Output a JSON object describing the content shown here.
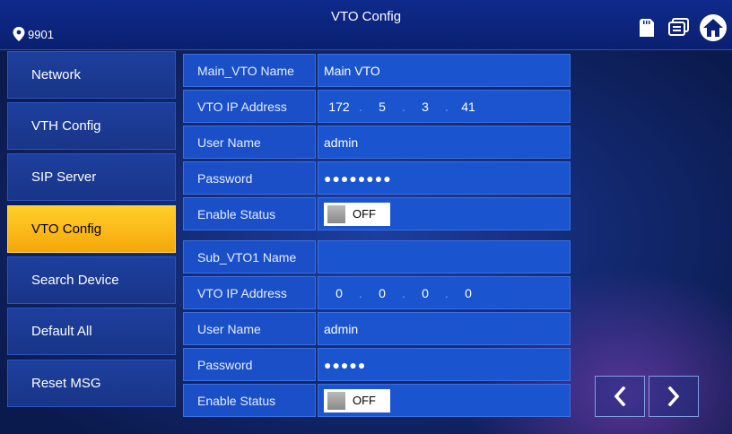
{
  "header": {
    "room_number": "9901",
    "title": "VTO Config",
    "icons": [
      "location-pin-icon",
      "sd-card-icon",
      "message-icon",
      "home-icon"
    ]
  },
  "sidebar": {
    "items": [
      {
        "label": "Network"
      },
      {
        "label": "VTH Config"
      },
      {
        "label": "SIP Server"
      },
      {
        "label": "VTO Config",
        "active": true
      },
      {
        "label": "Search Device"
      },
      {
        "label": "Default All"
      },
      {
        "label": "Reset MSG"
      }
    ]
  },
  "main_vto": {
    "name_label": "Main_VTO Name",
    "name_value": "Main VTO",
    "ip_label": "VTO IP Address",
    "ip": [
      "172",
      "5",
      "3",
      "41"
    ],
    "user_label": "User Name",
    "user_value": "admin",
    "password_label": "Password",
    "password_value": "●●●●●●●●",
    "status_label": "Enable Status",
    "status_value": "OFF"
  },
  "sub_vto1": {
    "name_label": "Sub_VTO1 Name",
    "name_value": "",
    "ip_label": "VTO IP Address",
    "ip": [
      "0",
      "0",
      "0",
      "0"
    ],
    "user_label": "User Name",
    "user_value": "admin",
    "password_label": "Password",
    "password_value": "●●●●●",
    "status_label": "Enable Status",
    "status_value": "OFF"
  },
  "colors": {
    "active_tab": "#f5b014",
    "field_blue": "#1b54cf",
    "background": "#12286e"
  }
}
